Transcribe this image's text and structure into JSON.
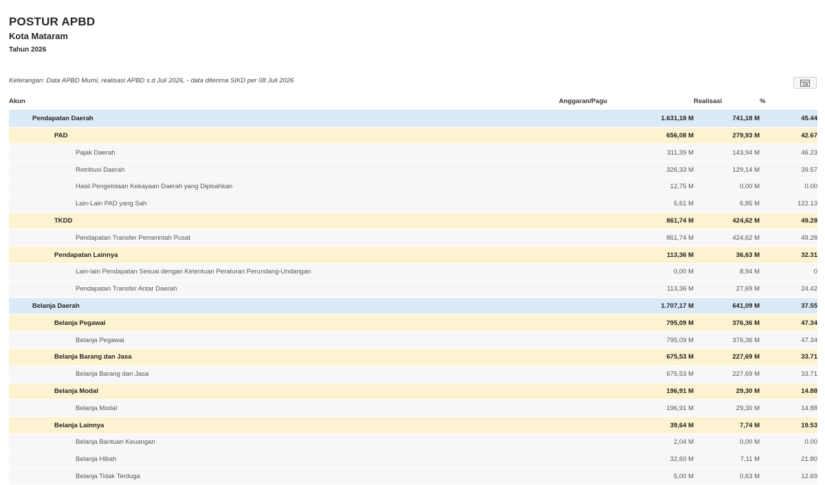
{
  "header": {
    "title": "POSTUR APBD",
    "subtitle": "Kota Mataram",
    "year": "Tahun 2026"
  },
  "note": "Keterangan: Data APBD Murni, realisasi APBD s.d Juli 2026, - data diterima SIKD per 08 Juli 2026",
  "export_button": {
    "icon": "export-excel-icon"
  },
  "table": {
    "columns": [
      "Akun",
      "Anggaran/Pagu",
      "Realisasi",
      "%"
    ],
    "rows": [
      {
        "level": 0,
        "akun": "Pendapatan Daerah",
        "pagu": "1.631,18 M",
        "realisasi": "741,18 M",
        "persen": "45.44"
      },
      {
        "level": 1,
        "akun": "PAD",
        "pagu": "656,08 M",
        "realisasi": "279,93 M",
        "persen": "42.67"
      },
      {
        "level": 2,
        "akun": "Pajak Daerah",
        "pagu": "311,39 M",
        "realisasi": "143,94 M",
        "persen": "46.23"
      },
      {
        "level": 2,
        "akun": "Retribusi Daerah",
        "pagu": "326,33 M",
        "realisasi": "129,14 M",
        "persen": "39.57"
      },
      {
        "level": 2,
        "akun": "Hasil Pengelolaan Kekayaan Daerah yang Dipisahkan",
        "pagu": "12,75 M",
        "realisasi": "0,00 M",
        "persen": "0.00"
      },
      {
        "level": 2,
        "akun": "Lain-Lain PAD yang Sah",
        "pagu": "5,61 M",
        "realisasi": "6,85 M",
        "persen": "122.13"
      },
      {
        "level": 1,
        "akun": "TKDD",
        "pagu": "861,74 M",
        "realisasi": "424,62 M",
        "persen": "49.28"
      },
      {
        "level": 2,
        "akun": "Pendapatan Transfer Pemerintah Pusat",
        "pagu": "861,74 M",
        "realisasi": "424,62 M",
        "persen": "49.28"
      },
      {
        "level": 1,
        "akun": "Pendapatan Lainnya",
        "pagu": "113,36 M",
        "realisasi": "36,63 M",
        "persen": "32.31"
      },
      {
        "level": 2,
        "akun": "Lain-lain Pendapatan Sesuai dengan Ketentuan Peraturan Perundang-Undangan",
        "pagu": "0,00 M",
        "realisasi": "8,94 M",
        "persen": "0"
      },
      {
        "level": 2,
        "akun": "Pendapatan Transfer Antar Daerah",
        "pagu": "113,36 M",
        "realisasi": "27,69 M",
        "persen": "24.42"
      },
      {
        "level": 0,
        "akun": "Belanja Daerah",
        "pagu": "1.707,17 M",
        "realisasi": "641,09 M",
        "persen": "37.55"
      },
      {
        "level": 1,
        "akun": "Belanja Pegawai",
        "pagu": "795,09 M",
        "realisasi": "376,36 M",
        "persen": "47.34"
      },
      {
        "level": 2,
        "akun": "Belanja Pegawai",
        "pagu": "795,09 M",
        "realisasi": "376,36 M",
        "persen": "47.34"
      },
      {
        "level": 1,
        "akun": "Belanja Barang dan Jasa",
        "pagu": "675,53 M",
        "realisasi": "227,69 M",
        "persen": "33.71"
      },
      {
        "level": 2,
        "akun": "Belanja Barang dan Jasa",
        "pagu": "675,53 M",
        "realisasi": "227,69 M",
        "persen": "33.71"
      },
      {
        "level": 1,
        "akun": "Belanja Modal",
        "pagu": "196,91 M",
        "realisasi": "29,30 M",
        "persen": "14.88"
      },
      {
        "level": 2,
        "akun": "Belanja Modal",
        "pagu": "196,91 M",
        "realisasi": "29,30 M",
        "persen": "14.88"
      },
      {
        "level": 1,
        "akun": "Belanja Lainnya",
        "pagu": "39,64 M",
        "realisasi": "7,74 M",
        "persen": "19.53"
      },
      {
        "level": 2,
        "akun": "Belanja Bantuan Keuangan",
        "pagu": "2,04 M",
        "realisasi": "0,00 M",
        "persen": "0.00"
      },
      {
        "level": 2,
        "akun": "Belanja Hibah",
        "pagu": "32,60 M",
        "realisasi": "7,11 M",
        "persen": "21.80"
      },
      {
        "level": 2,
        "akun": "Belanja Tidak Terduga",
        "pagu": "5,00 M",
        "realisasi": "0,63 M",
        "persen": "12.69"
      }
    ]
  }
}
